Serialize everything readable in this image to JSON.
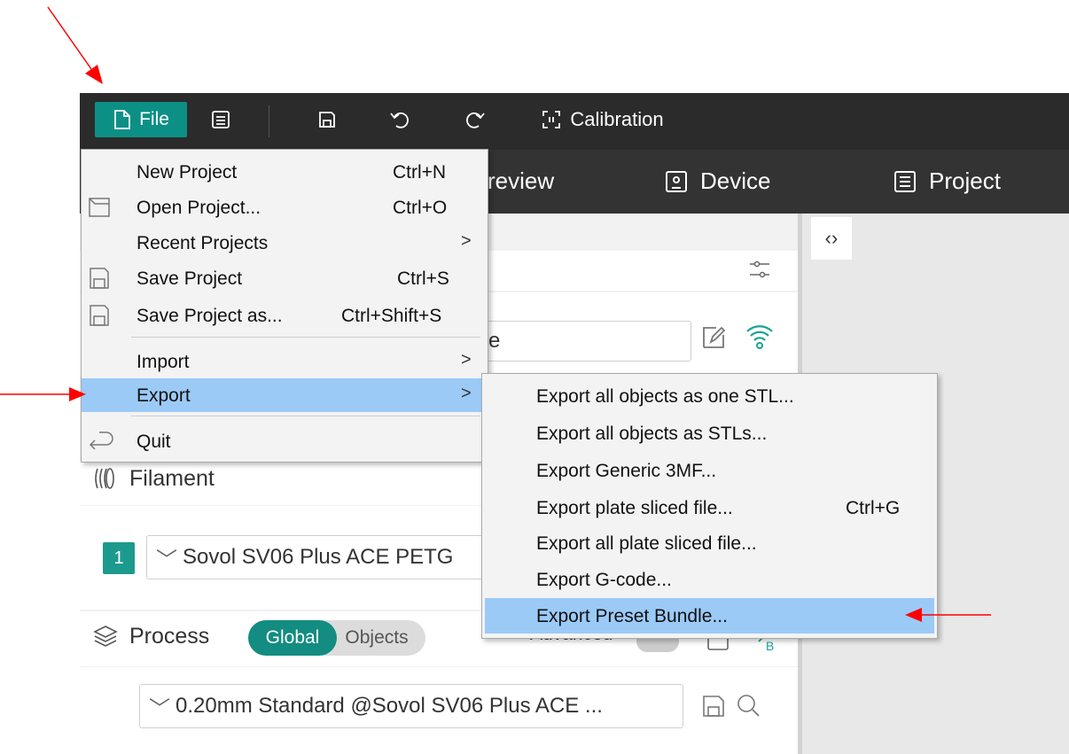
{
  "toolbar": {
    "file_label": "File",
    "calibration_label": "Calibration"
  },
  "tabs": [
    {
      "label": "review"
    },
    {
      "label": "Device"
    },
    {
      "label": "Project"
    }
  ],
  "file_menu": {
    "items": [
      {
        "label": "New Project",
        "shortcut": "Ctrl+N"
      },
      {
        "label": "Open Project...",
        "shortcut": "Ctrl+O"
      },
      {
        "label": "Recent Projects",
        "submenu": ">"
      },
      {
        "label": "Save Project",
        "shortcut": "Ctrl+S"
      },
      {
        "label": "Save Project as...",
        "shortcut": "Ctrl+Shift+S"
      },
      {
        "label": "Import",
        "submenu": ">"
      },
      {
        "label": "Export",
        "submenu": ">"
      },
      {
        "label": "Quit"
      }
    ]
  },
  "export_menu": {
    "items": [
      {
        "label": "Export all objects as one STL..."
      },
      {
        "label": "Export all objects as STLs..."
      },
      {
        "label": "Export Generic 3MF..."
      },
      {
        "label": "Export plate sliced file...",
        "shortcut": "Ctrl+G"
      },
      {
        "label": "Export all plate sliced file..."
      },
      {
        "label": "Export G-code..."
      },
      {
        "label": "Export Preset Bundle..."
      }
    ]
  },
  "sidebar": {
    "printer_name_partial": "e",
    "filament_title": "Filament",
    "filament_index": "1",
    "filament_preset": "Sovol SV06 Plus ACE PETG",
    "process_title": "Process",
    "toggle_global": "Global",
    "toggle_objects": "Objects",
    "advanced_label": "Advanced",
    "process_preset": "0.20mm Standard @Sovol SV06 Plus ACE ..."
  },
  "colors": {
    "accent": "#0c9086",
    "highlight": "#9ccaf7",
    "annotation": "#ff0000"
  }
}
